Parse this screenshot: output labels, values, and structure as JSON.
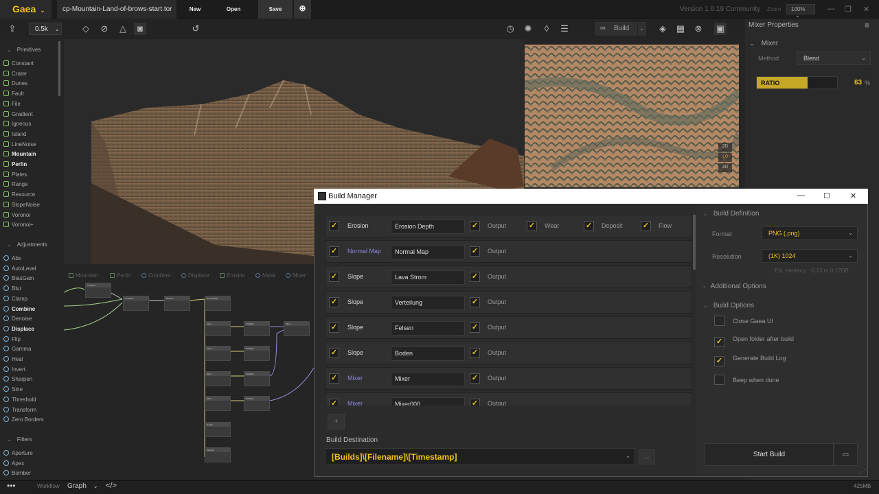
{
  "app": {
    "logo": "Gaea",
    "file_tab": "cp-Mountain-Land-of-brows-start.tor",
    "new_label": "New",
    "open_label": "Open",
    "save_label": "Save",
    "version": "Version 1.0.19 Community",
    "zoom_label": "Zoom",
    "zoom_value": "100%",
    "accent": "#f0c419"
  },
  "toolbar": {
    "resolution": "0.5k",
    "build_label": "Build"
  },
  "sidebar": {
    "primitives_title": "Primitives",
    "primitives": [
      {
        "label": "Constant",
        "bold": false
      },
      {
        "label": "Crater",
        "bold": false
      },
      {
        "label": "Dunes",
        "bold": false
      },
      {
        "label": "Fault",
        "bold": false
      },
      {
        "label": "File",
        "bold": false
      },
      {
        "label": "Gradient",
        "bold": false
      },
      {
        "label": "Igneous",
        "bold": false
      },
      {
        "label": "Island",
        "bold": false
      },
      {
        "label": "LineNoise",
        "bold": false
      },
      {
        "label": "Mountain",
        "bold": true
      },
      {
        "label": "Perlin",
        "bold": true
      },
      {
        "label": "Plates",
        "bold": false
      },
      {
        "label": "Range",
        "bold": false
      },
      {
        "label": "Resource",
        "bold": false
      },
      {
        "label": "SlopeNoise",
        "bold": false
      },
      {
        "label": "Voronoi",
        "bold": false
      },
      {
        "label": "Voronoi+",
        "bold": false
      }
    ],
    "adjustments_title": "Adjustments",
    "adjustments": [
      {
        "label": "Abs",
        "bold": false
      },
      {
        "label": "AutoLevel",
        "bold": false
      },
      {
        "label": "BiasGain",
        "bold": false
      },
      {
        "label": "Blur",
        "bold": false
      },
      {
        "label": "Clamp",
        "bold": false
      },
      {
        "label": "Combine",
        "bold": true
      },
      {
        "label": "Denoise",
        "bold": false
      },
      {
        "label": "Displace",
        "bold": true
      },
      {
        "label": "Flip",
        "bold": false
      },
      {
        "label": "Gamma",
        "bold": false
      },
      {
        "label": "Heal",
        "bold": false
      },
      {
        "label": "Invert",
        "bold": false
      },
      {
        "label": "Sharpen",
        "bold": false
      },
      {
        "label": "Sine",
        "bold": false
      },
      {
        "label": "Threshold",
        "bold": false
      },
      {
        "label": "Transform",
        "bold": false
      },
      {
        "label": "Zero Borders",
        "bold": false
      }
    ],
    "filters_title": "Filters",
    "filters": [
      {
        "label": "Aperture",
        "bold": false
      },
      {
        "label": "Apex",
        "bold": false
      },
      {
        "label": "Bomber",
        "bold": false
      }
    ]
  },
  "viewport": {
    "btn_2d": "2D",
    "btn_mid": "L0",
    "btn_3d": "3D"
  },
  "graph": {
    "tabs": [
      "Mountain",
      "Perlin",
      "Combine",
      "Displace",
      "Erosion",
      "Mask",
      "Mixer"
    ],
    "nodes": {
      "combine1": "Combine",
      "combine2": "Combine",
      "erosion": "Erosion",
      "normalmap": "Normal Map",
      "slope": "Slope",
      "satmaps": "SatMaps",
      "mixer": "Mixer",
      "height": "Height",
      "velocity": "Velocity"
    }
  },
  "properties": {
    "title": "Mixer Properties",
    "section": "Mixer",
    "method_label": "Method",
    "method_value": "Blend",
    "ratio_label": "RATIO",
    "ratio_value": "63",
    "ratio_unit": "%",
    "ratio_fraction": 0.63
  },
  "build_manager": {
    "title": "Build Manager",
    "rows": [
      {
        "type": "Erosion",
        "type_color": "#dddddd",
        "name": "Erosion Depth",
        "outputs": [
          {
            "label": "Output"
          },
          {
            "label": "Wear"
          },
          {
            "label": "Deposit"
          },
          {
            "label": "Flow"
          }
        ]
      },
      {
        "type": "Normal Map",
        "type_color": "#8a86e0",
        "name": "Normal Map",
        "outputs": [
          {
            "label": "Output"
          }
        ]
      },
      {
        "type": "Slope",
        "type_color": "#dddddd",
        "name": "Lava Strom",
        "outputs": [
          {
            "label": "Output"
          }
        ]
      },
      {
        "type": "Slope",
        "type_color": "#dddddd",
        "name": "Verteilung",
        "outputs": [
          {
            "label": "Output"
          }
        ]
      },
      {
        "type": "Slope",
        "type_color": "#dddddd",
        "name": "Felsen",
        "outputs": [
          {
            "label": "Output"
          }
        ]
      },
      {
        "type": "Slope",
        "type_color": "#dddddd",
        "name": "Boden",
        "outputs": [
          {
            "label": "Output"
          }
        ]
      },
      {
        "type": "Mixer",
        "type_color": "#8a86e0",
        "name": "Mixer",
        "outputs": [
          {
            "label": "Output"
          }
        ]
      },
      {
        "type": "Mixer",
        "type_color": "#8a86e0",
        "name": "Mixer000",
        "outputs": [
          {
            "label": "Output"
          }
        ]
      }
    ],
    "add_label": "+",
    "destination_label": "Build Destination",
    "destination_value": "[Builds]\\[Filename]\\[Timestamp]",
    "browse_label": "...",
    "definition_title": "Build Definition",
    "format_label": "Format",
    "format_value": "PNG (.png)",
    "resolution_label": "Resolution",
    "resolution_value": "(1K) 1024",
    "memory_note": "Est. memory: ~0.13 to 0.17GB",
    "additional_title": "Additional Options",
    "options_title": "Build Options",
    "options": [
      {
        "label": "Close Gaea UI",
        "checked": false
      },
      {
        "label": "Open folder after build",
        "checked": true
      },
      {
        "label": "Generate Build Log",
        "checked": true
      },
      {
        "label": "Beep when done",
        "checked": false
      }
    ],
    "start_label": "Start Build"
  },
  "status": {
    "workflow_label": "Workflow",
    "graph_label": "Graph",
    "memory": "425MB"
  }
}
